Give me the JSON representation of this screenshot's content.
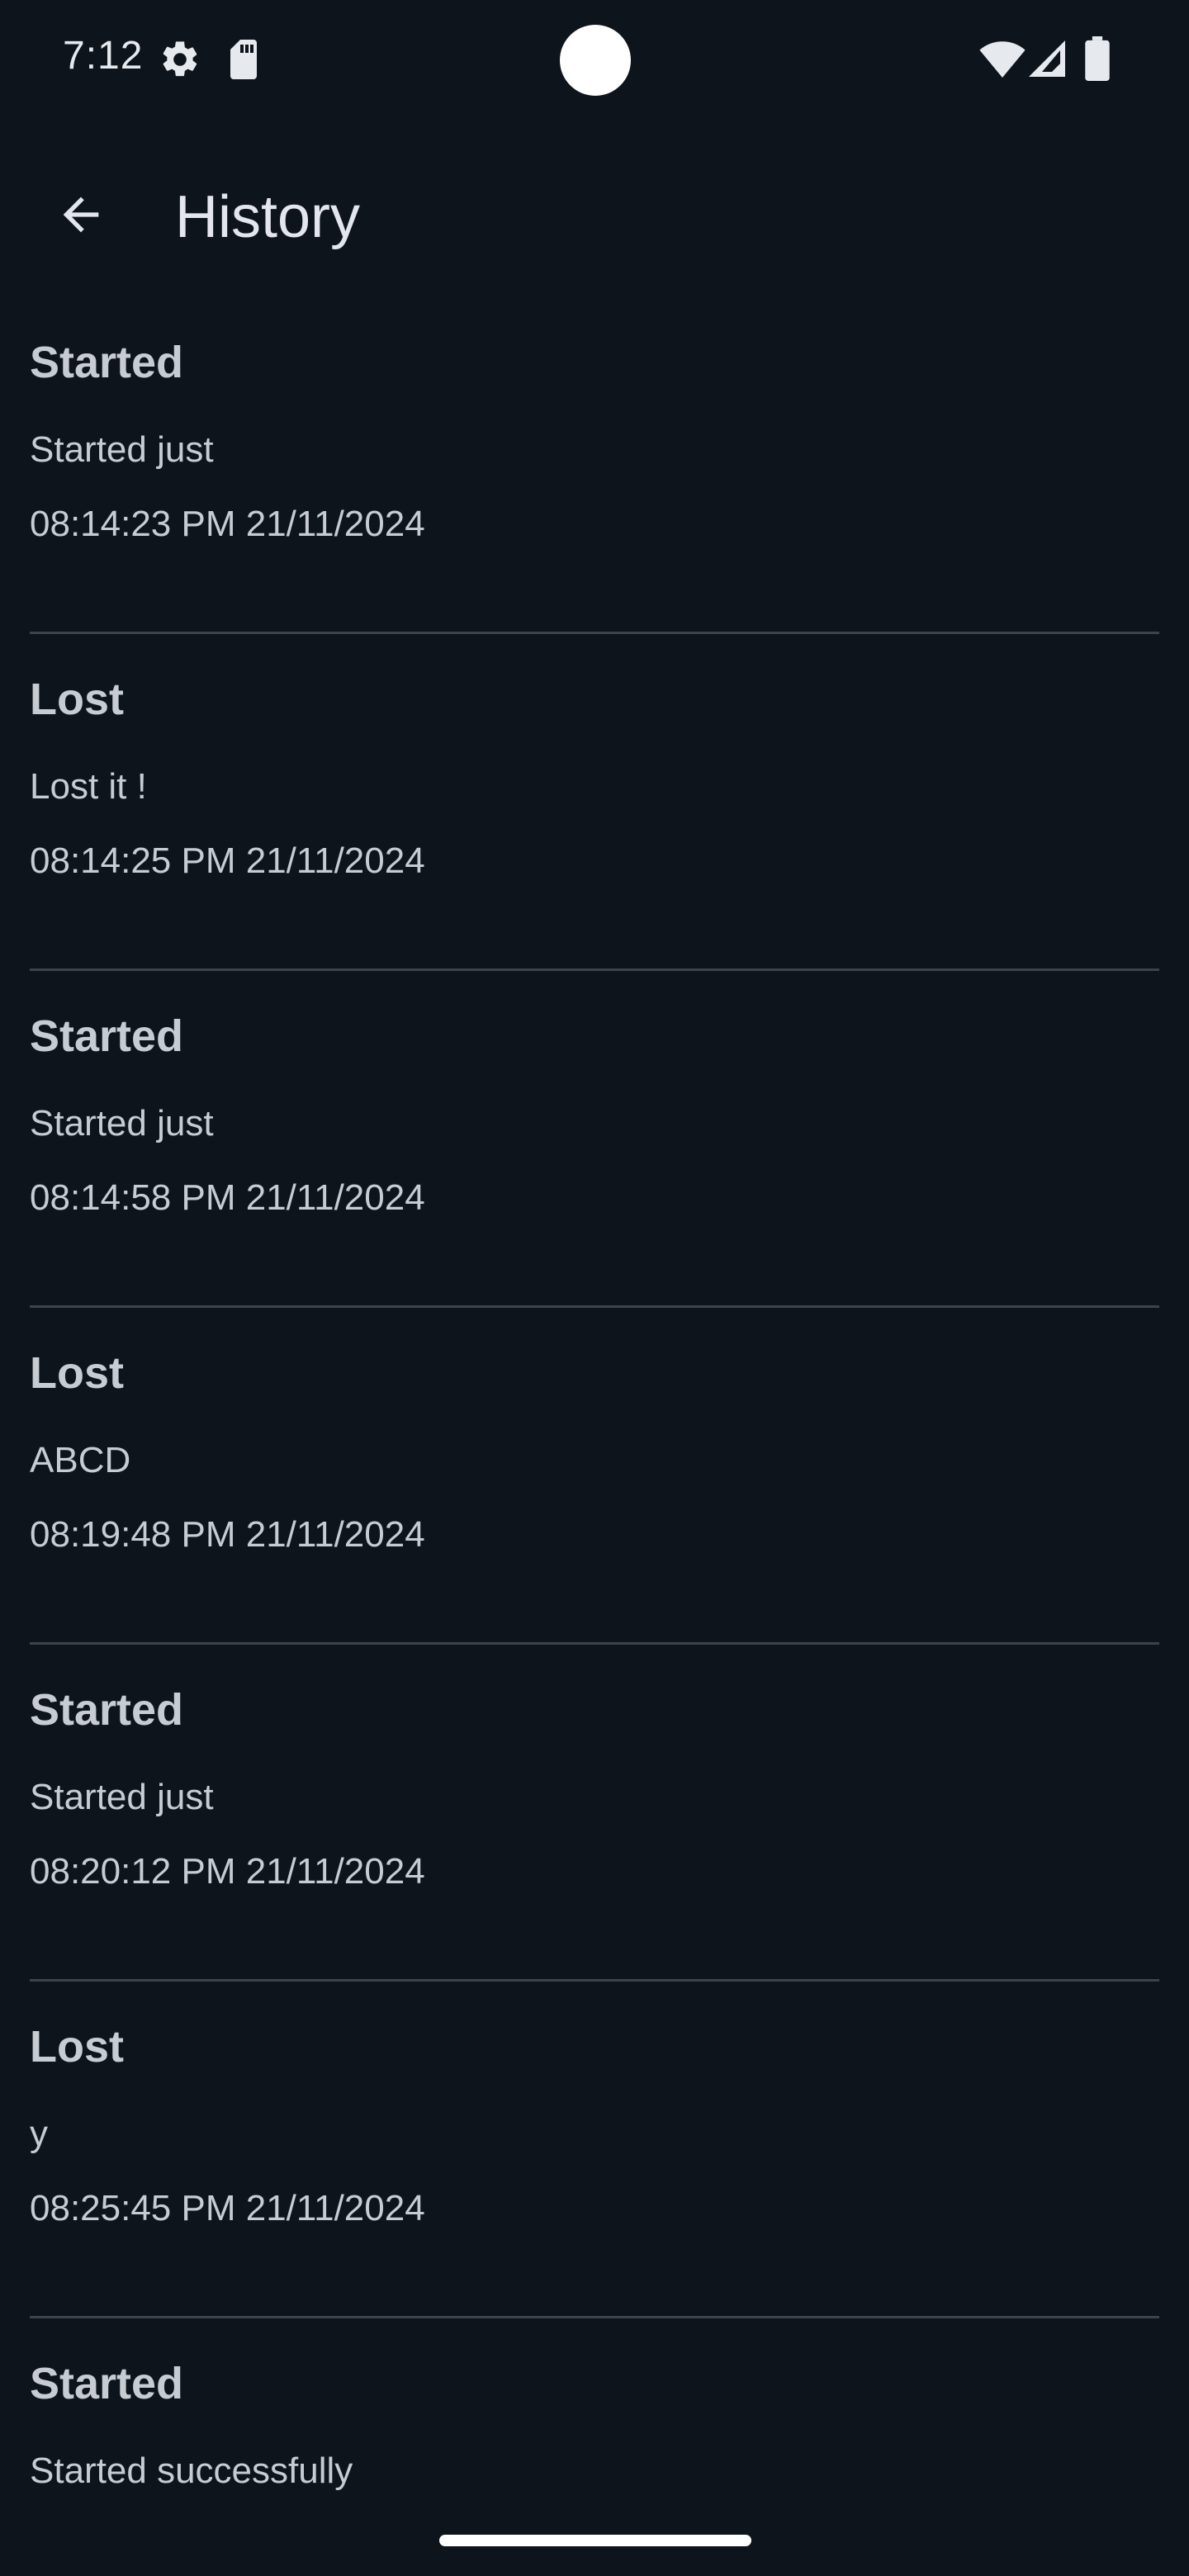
{
  "status_bar": {
    "time": "7:12",
    "left_icons": [
      "settings-gear-icon",
      "sd-card-icon"
    ],
    "right_icons": [
      "wifi-icon",
      "cellular-signal-icon",
      "battery-icon"
    ]
  },
  "app_bar": {
    "back_icon": "arrow-back-icon",
    "title": "History"
  },
  "history": [
    {
      "title": "Started",
      "message": "Started just",
      "time": "08:14:23 PM 21/11/2024"
    },
    {
      "title": "Lost",
      "message": "Lost it !",
      "time": "08:14:25 PM 21/11/2024"
    },
    {
      "title": "Started",
      "message": "Started just",
      "time": "08:14:58 PM 21/11/2024"
    },
    {
      "title": "Lost",
      "message": "ABCD",
      "time": "08:19:48 PM 21/11/2024"
    },
    {
      "title": "Started",
      "message": "Started just",
      "time": "08:20:12 PM 21/11/2024"
    },
    {
      "title": "Lost",
      "message": "y",
      "time": "08:25:45 PM 21/11/2024"
    },
    {
      "title": "Started",
      "message": "Started successfully",
      "time": ""
    }
  ],
  "colors": {
    "background": "#0e141b",
    "text_primary": "#e3e6ec",
    "text_secondary": "#c7cbd2",
    "divider": "#3c434c"
  }
}
